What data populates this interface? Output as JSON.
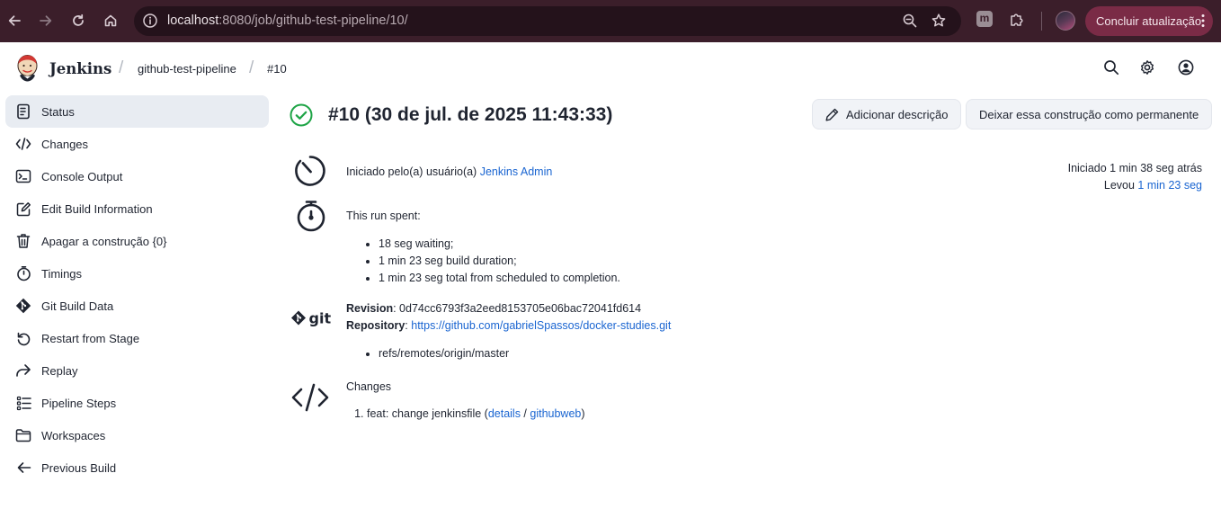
{
  "browser": {
    "url_host": "localhost",
    "url_path": ":8080/job/github-test-pipeline/10/",
    "update_button_label": "Concluir atualização",
    "ext_badge": "m"
  },
  "header": {
    "app_title": "Jenkins",
    "breadcrumbs": [
      "github-test-pipeline",
      "#10"
    ]
  },
  "sidebar": {
    "items": [
      {
        "label": "Status",
        "icon": "document-icon",
        "active": true
      },
      {
        "label": "Changes",
        "icon": "code-icon"
      },
      {
        "label": "Console Output",
        "icon": "terminal-icon"
      },
      {
        "label": "Edit Build Information",
        "icon": "edit-icon"
      },
      {
        "label": "Apagar a construção {0}",
        "icon": "trash-icon"
      },
      {
        "label": "Timings",
        "icon": "stopwatch-icon"
      },
      {
        "label": "Git Build Data",
        "icon": "git-icon"
      },
      {
        "label": "Restart from Stage",
        "icon": "restart-icon"
      },
      {
        "label": "Replay",
        "icon": "replay-icon"
      },
      {
        "label": "Pipeline Steps",
        "icon": "steps-icon"
      },
      {
        "label": "Workspaces",
        "icon": "folder-icon"
      },
      {
        "label": "Previous Build",
        "icon": "arrow-left-icon"
      }
    ]
  },
  "build": {
    "title": "#10 (30 de jul. de 2025 11:43:33)",
    "status_color": "#1ea446",
    "add_description_label": "Adicionar descrição",
    "keep_forever_label": "Deixar essa construção como permanente",
    "started_by_prefix": "Iniciado pelo(a) usuário(a) ",
    "started_by_user": "Jenkins Admin",
    "started_ago": "Iniciado 1 min 38 seg atrás",
    "took_prefix": "Levou ",
    "took_value": "1 min 23 seg",
    "run_spent_label": "This run spent:",
    "run_spent_items": [
      "18 seg waiting;",
      "1 min 23 seg build duration;",
      "1 min 23 seg total from scheduled to completion."
    ],
    "revision_label": "Revision",
    "revision_value": ": 0d74cc6793f3a2eed8153705e06bac72041fd614",
    "repository_label": "Repository",
    "repository_sep": ": ",
    "repository_url": "https://github.com/gabrielSpassos/docker-studies.git",
    "refs": [
      "refs/remotes/origin/master"
    ],
    "changes_label": "Changes",
    "change_item_text": "feat: change jenkinsfile (",
    "change_details": "details",
    "change_sep": " / ",
    "change_githubweb": "githubweb",
    "change_close": ")",
    "git_logo_text": "git"
  },
  "colors": {
    "link": "#1a65d1",
    "chrome_bg": "#3b1e2a",
    "sidebar_active": "#e8ecf2"
  }
}
